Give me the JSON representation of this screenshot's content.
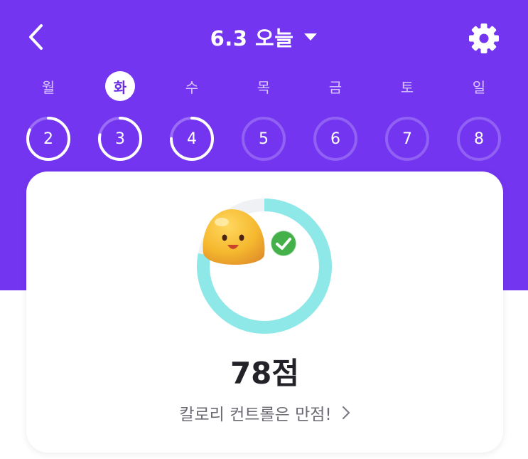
{
  "header": {
    "title": "6.3 오늘",
    "back_icon": "chevron-left-icon",
    "dropdown_icon": "caret-down-icon",
    "settings_icon": "gear-icon"
  },
  "colors": {
    "primary": "#7335f0",
    "ring_teal": "#8fe8e8",
    "ring_track": "#f0f1f4",
    "mascot": "#f5b82e",
    "check_badge": "#43b04a"
  },
  "week": [
    {
      "day": "월",
      "date": "2",
      "progress": 0.82,
      "active": false
    },
    {
      "day": "화",
      "date": "3",
      "progress": 0.78,
      "active": true
    },
    {
      "day": "수",
      "date": "4",
      "progress": 0.75,
      "active": false
    },
    {
      "day": "목",
      "date": "5",
      "progress": 0,
      "active": false
    },
    {
      "day": "금",
      "date": "6",
      "progress": 0,
      "active": false
    },
    {
      "day": "토",
      "date": "7",
      "progress": 0,
      "active": false
    },
    {
      "day": "일",
      "date": "8",
      "progress": 0,
      "active": false
    }
  ],
  "card": {
    "score_text": "78점",
    "score_value": 78,
    "score_max": 100,
    "message": "칼로리 컨트롤은 만점!",
    "mascot_icon": "smiling-blob-mascot-icon",
    "badge_icon": "check-badge-icon",
    "chevron_icon": "chevron-right-icon"
  }
}
